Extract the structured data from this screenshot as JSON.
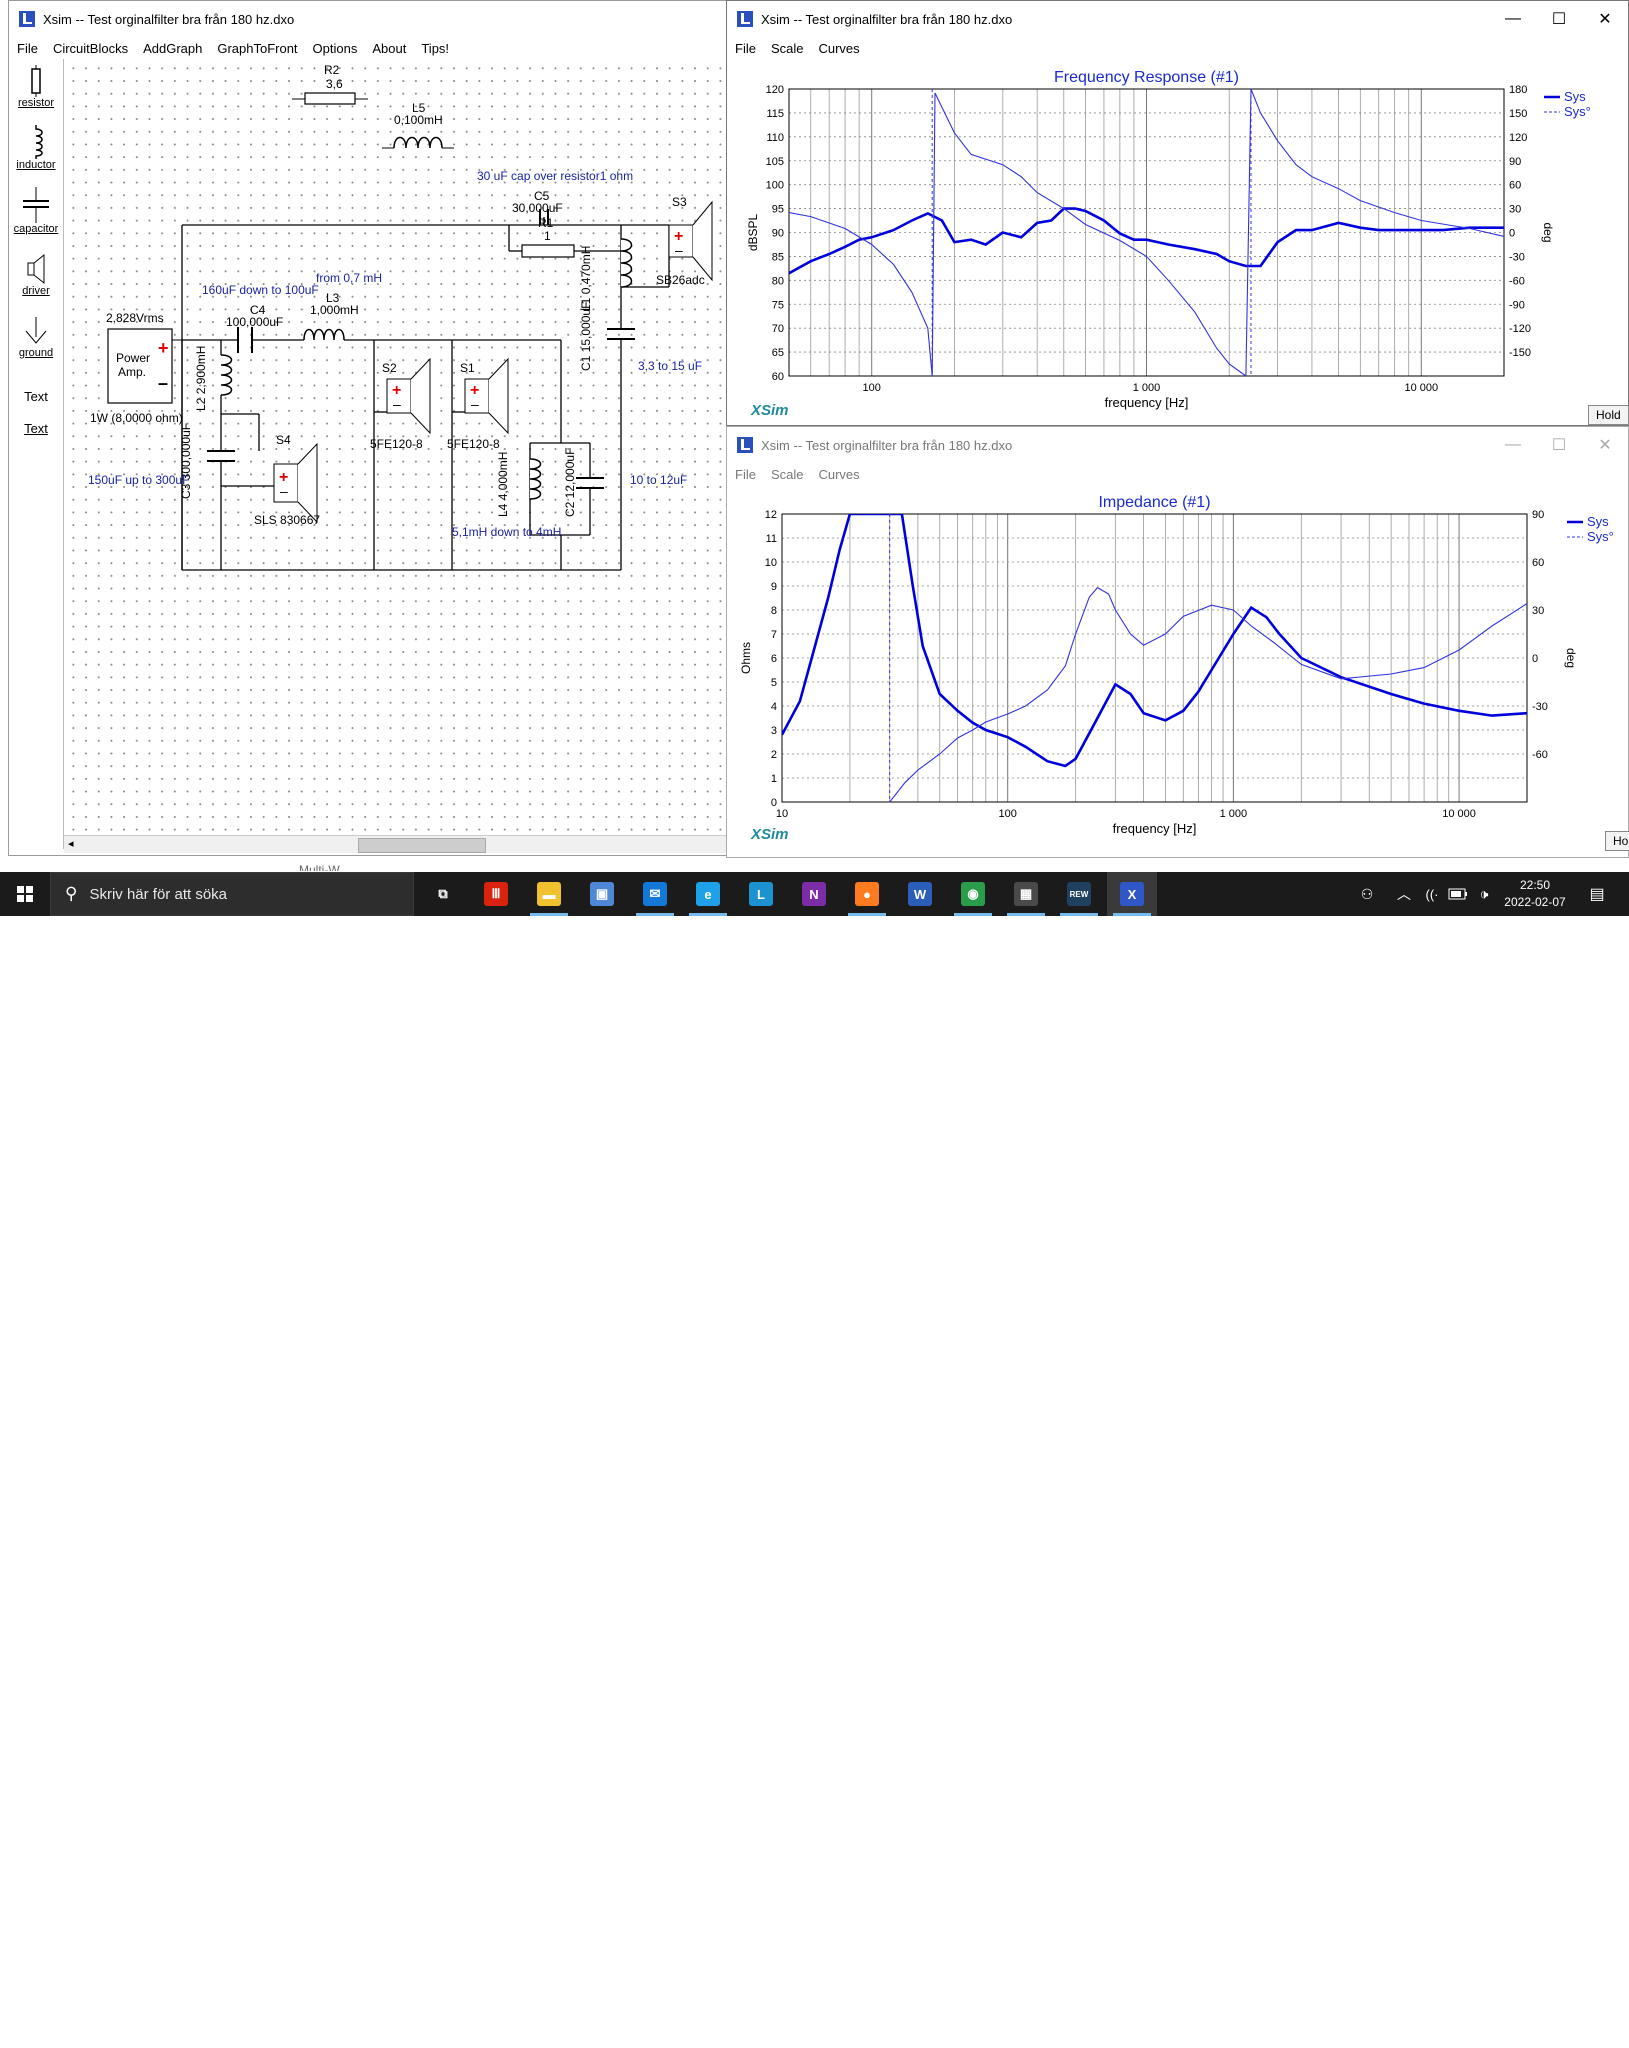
{
  "main_window": {
    "title": "Xsim -- Test orginalfilter bra från 180 hz.dxo",
    "menu": [
      "File",
      "CircuitBlocks",
      "AddGraph",
      "GraphToFront",
      "Options",
      "About",
      "Tips!"
    ],
    "toolbox": [
      {
        "label": "resistor",
        "icon": "resistor-icon"
      },
      {
        "label": "inductor",
        "icon": "inductor-icon"
      },
      {
        "label": "capacitor",
        "icon": "capacitor-icon"
      },
      {
        "label": "driver",
        "icon": "driver-icon"
      },
      {
        "label": "ground",
        "icon": "ground-icon"
      },
      {
        "label": "Text",
        "icon": "text-icon"
      },
      {
        "label": "Text",
        "icon": "text-link-icon"
      }
    ],
    "partial_hidden_text": "Multi-W",
    "schematic": {
      "r2_name": "R2",
      "r2_val": "3,6",
      "l5_name": "L5",
      "l5_val": "0,100mH",
      "note_c5": "30 uF cap over resistor1 ohm",
      "c5_name": "C5",
      "c5_val": "30,000uF",
      "r1_name": "R1",
      "r1_val": "1",
      "s3_name": "S3",
      "s3_model": "SB26adc",
      "l1_name": "L1",
      "l1_val": "0,470mH",
      "c1_name": "C1",
      "c1_val": "15,000uF",
      "note_c1": "3,3 to 15 uF",
      "note_c4": "160uF down to 100uF",
      "note_l3": "from 0,7 mH",
      "c4_name": "C4",
      "c4_val": "100,000uF",
      "l3_name": "L3",
      "l3_val": "1,000mH",
      "amp_voltage": "2,828Vrms",
      "amp_label1": "Power",
      "amp_label2": "Amp.",
      "amp_power": "1W (8,0000 ohm)",
      "l2_name": "L2",
      "l2_val": "2,900mH",
      "s2_name": "S2",
      "s2_model": "5FE120-8",
      "s1_name": "S1",
      "s1_model": "5FE120-8",
      "c3_name": "C3",
      "c3_val": "300,000uF",
      "note_c3": "150uF up to 300uF",
      "s4_name": "S4",
      "s4_model": "SLS 830667",
      "l4_name": "L4",
      "l4_val": "4,000mH",
      "c2_name": "C2",
      "c2_val": "12,000uF",
      "note_c2": "10 to 12uF",
      "note_l4": "5,1mH down to 4mH"
    }
  },
  "freq_window": {
    "title": "Xsim -- Test orginalfilter bra från 180 hz.dxo",
    "menu": [
      "File",
      "Scale",
      "Curves"
    ],
    "hold": "Hold"
  },
  "imp_window": {
    "title": "Xsim -- Test orginalfilter bra från 180 hz.dxo",
    "menu": [
      "File",
      "Scale",
      "Curves"
    ],
    "hold": "Hold"
  },
  "chart_data": [
    {
      "type": "line",
      "title": "Frequency Response (#1)",
      "xlabel": "frequency [Hz]",
      "ylabel": "dBSPL",
      "y2label": "deg",
      "xscale": "log",
      "xlim": [
        50,
        20000
      ],
      "ylim": [
        60,
        120
      ],
      "y2lim": [
        -180,
        180
      ],
      "xticks": [
        100,
        1000,
        10000
      ],
      "xtick_labels": [
        "100",
        "1 000",
        "10 000"
      ],
      "yticks": [
        60,
        65,
        70,
        75,
        80,
        85,
        90,
        95,
        100,
        105,
        110,
        115,
        120
      ],
      "y2ticks": [
        180,
        150,
        120,
        90,
        60,
        30,
        0,
        -30,
        -60,
        -90,
        -120,
        -150
      ],
      "legend_position": "top-right",
      "watermark": "XSim",
      "series": [
        {
          "name": "Sys",
          "style": "solid",
          "color": "#0000dd",
          "x": [
            50,
            60,
            70,
            80,
            90,
            100,
            120,
            140,
            160,
            180,
            200,
            230,
            260,
            300,
            350,
            400,
            450,
            500,
            550,
            600,
            700,
            800,
            900,
            1000,
            1200,
            1500,
            1800,
            2000,
            2300,
            2600,
            3000,
            3500,
            4000,
            5000,
            6000,
            7000,
            8000,
            10000,
            12000,
            15000,
            20000
          ],
          "y": [
            81.5,
            84,
            85.5,
            87,
            88.5,
            89,
            90.5,
            92.5,
            94,
            92.5,
            88,
            88.5,
            87.5,
            90,
            89,
            92,
            92.5,
            95,
            95,
            94.5,
            92.5,
            89.8,
            88.5,
            88.5,
            87.5,
            86.5,
            85.5,
            84,
            83,
            83,
            88,
            90.5,
            90.5,
            92,
            91,
            90.5,
            90.5,
            90.5,
            90.5,
            91,
            91
          ]
        },
        {
          "name": "Sys°",
          "style": "dashed",
          "color": "#3333dd",
          "x": [
            50,
            60,
            80,
            100,
            120,
            140,
            160,
            166,
            170,
            200,
            230,
            300,
            350,
            400,
            500,
            600,
            800,
            1000,
            1200,
            1500,
            1800,
            2000,
            2300,
            2400,
            2600,
            3000,
            3500,
            4000,
            5000,
            6000,
            8000,
            10000,
            15000,
            20000
          ],
          "y": [
            25,
            20,
            5,
            -15,
            -40,
            -75,
            -120,
            -180,
            175,
            125,
            98,
            85,
            70,
            50,
            30,
            10,
            -10,
            -30,
            -60,
            -100,
            -145,
            -165,
            -180,
            180,
            150,
            115,
            85,
            70,
            55,
            40,
            25,
            15,
            5,
            -5
          ]
        }
      ]
    },
    {
      "type": "line",
      "title": "Impedance (#1)",
      "xlabel": "frequency [Hz]",
      "ylabel": "Ohms",
      "y2label": "deg",
      "xscale": "log",
      "xlim": [
        10,
        20000
      ],
      "ylim": [
        0,
        12
      ],
      "y2lim": [
        -90,
        90
      ],
      "xticks": [
        10,
        100,
        1000,
        10000
      ],
      "xtick_labels": [
        "10",
        "100",
        "1 000",
        "10 000"
      ],
      "yticks": [
        0,
        1,
        2,
        3,
        4,
        5,
        6,
        7,
        8,
        9,
        10,
        11,
        12
      ],
      "y2ticks": [
        90,
        60,
        30,
        0,
        -30,
        -60
      ],
      "legend_position": "top-right",
      "watermark": "XSim",
      "series": [
        {
          "name": "Sys",
          "style": "solid",
          "color": "#0000dd",
          "x": [
            10,
            12,
            14,
            16,
            18,
            20,
            22,
            34,
            38,
            42,
            50,
            60,
            70,
            80,
            100,
            120,
            150,
            180,
            200,
            250,
            300,
            350,
            400,
            500,
            600,
            700,
            800,
            1000,
            1200,
            1400,
            1600,
            2000,
            3000,
            5000,
            7000,
            10000,
            14000,
            20000
          ],
          "y": [
            2.8,
            4.2,
            6.5,
            8.5,
            10.5,
            12,
            12,
            12,
            9,
            6.5,
            4.5,
            3.8,
            3.3,
            3,
            2.7,
            2.3,
            1.7,
            1.5,
            1.8,
            3.5,
            4.9,
            4.5,
            3.7,
            3.4,
            3.8,
            4.6,
            5.5,
            7,
            8.1,
            7.7,
            7.0,
            6.0,
            5.2,
            4.5,
            4.1,
            3.8,
            3.6,
            3.7
          ]
        },
        {
          "name": "Sys°",
          "style": "dashed",
          "color": "#3333dd",
          "x": [
            30,
            32,
            35,
            40,
            50,
            60,
            70,
            80,
            100,
            120,
            150,
            180,
            200,
            230,
            250,
            280,
            300,
            350,
            400,
            500,
            600,
            800,
            1000,
            1200,
            1500,
            2000,
            3000,
            5000,
            7000,
            10000,
            14000,
            20000
          ],
          "y": [
            -90,
            -85,
            -78,
            -70,
            -60,
            -50,
            -45,
            -40,
            -35,
            -30,
            -20,
            -5,
            15,
            38,
            44,
            40,
            30,
            15,
            8,
            15,
            26,
            33,
            30,
            20,
            10,
            -4,
            -13,
            -10,
            -6,
            5,
            20,
            34
          ]
        }
      ]
    }
  ],
  "taskbar": {
    "search_placeholder": "Skriv här för att söka",
    "clock_time": "22:50",
    "clock_date": "2022-02-07",
    "apps": [
      {
        "name": "task-view",
        "glyph": "⧉",
        "color": "#1b1b1b"
      },
      {
        "name": "app-red",
        "glyph": "Ⅲ",
        "color": "#d9230f"
      },
      {
        "name": "file-explorer",
        "glyph": "▬",
        "color": "#f2c12e"
      },
      {
        "name": "store",
        "glyph": "▣",
        "color": "#4f86d6"
      },
      {
        "name": "mail",
        "glyph": "✉",
        "color": "#1378d7"
      },
      {
        "name": "internet-explorer",
        "glyph": "e",
        "color": "#1ea1e8"
      },
      {
        "name": "app-l",
        "glyph": "L",
        "color": "#1c93d0"
      },
      {
        "name": "onenote",
        "glyph": "N",
        "color": "#7b2da6"
      },
      {
        "name": "firefox",
        "glyph": "●",
        "color": "#ff7b20"
      },
      {
        "name": "word",
        "glyph": "W",
        "color": "#2b5eb8"
      },
      {
        "name": "chrome",
        "glyph": "◉",
        "color": "#2a9d4b"
      },
      {
        "name": "calculator",
        "glyph": "▦",
        "color": "#4a4a4a"
      },
      {
        "name": "rew",
        "glyph": "REW",
        "color": "#204060"
      },
      {
        "name": "xsim",
        "glyph": "X",
        "color": "#3057c8"
      }
    ]
  }
}
